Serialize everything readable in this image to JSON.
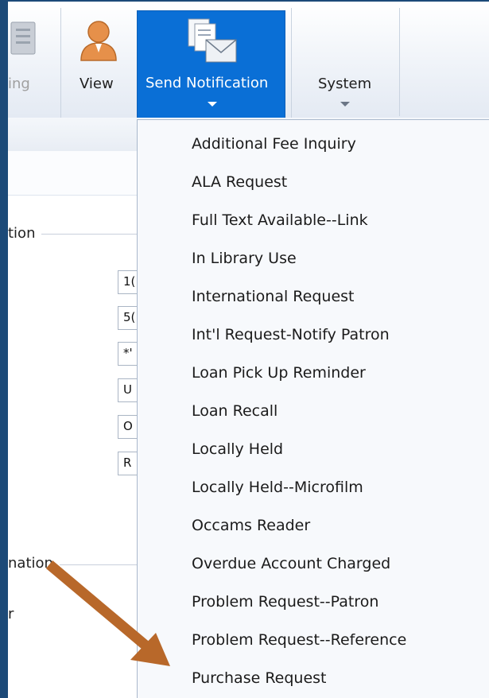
{
  "ribbon": {
    "partial_button_label": "ing",
    "partial_group_label": "ling",
    "view_label": "View",
    "send_notification_label": "Send Notification",
    "system_label": "System"
  },
  "panel": {
    "section1_label": "tion",
    "section2_label": "nation",
    "partial_row_label": "r",
    "fields": [
      "1(",
      "5(",
      "*'",
      "U",
      "O",
      "R"
    ]
  },
  "menu": {
    "items": [
      "Additional Fee Inquiry",
      "ALA Request",
      "Full Text Available--Link",
      "In Library Use",
      "International Request",
      "Int'l Request-Notify Patron",
      "Loan Pick Up Reminder",
      "Loan Recall",
      "Locally Held",
      "Locally Held--Microfilm",
      "Occams Reader",
      "Overdue Account Charged",
      "Problem Request--Patron",
      "Problem Request--Reference",
      "Purchase Request"
    ]
  },
  "colors": {
    "frame": "#1c4a78",
    "accent": "#0a6fd6",
    "arrow": "#b8682a"
  }
}
